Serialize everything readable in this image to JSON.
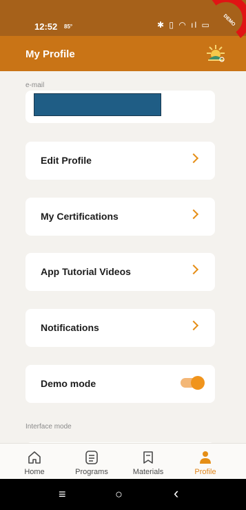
{
  "status": {
    "time": "12:52",
    "temp": "85°",
    "icons": "✱ ▯ ◠ ıl ▭"
  },
  "header": {
    "title": "My Profile"
  },
  "ribbon": {
    "text": "DEMO"
  },
  "email": {
    "label": "e-mail"
  },
  "menu": {
    "edit_profile": "Edit Profile",
    "certifications": "My Certifications",
    "tutorials": "App Tutorial Videos",
    "notifications": "Notifications",
    "demo_mode": "Demo mode"
  },
  "demo_mode_enabled": true,
  "interface_mode": {
    "label": "Interface mode"
  },
  "tabs": [
    {
      "label": "Home",
      "icon": "home-icon"
    },
    {
      "label": "Programs",
      "icon": "list-icon"
    },
    {
      "label": "Materials",
      "icon": "bookmark-icon"
    },
    {
      "label": "Profile",
      "icon": "person-icon",
      "active": true
    }
  ],
  "nav": {
    "menu": "≡",
    "home": "○",
    "back": "‹"
  },
  "colors": {
    "accent": "#e58e16",
    "header": "#c97416",
    "statusbar": "#a6611a"
  }
}
